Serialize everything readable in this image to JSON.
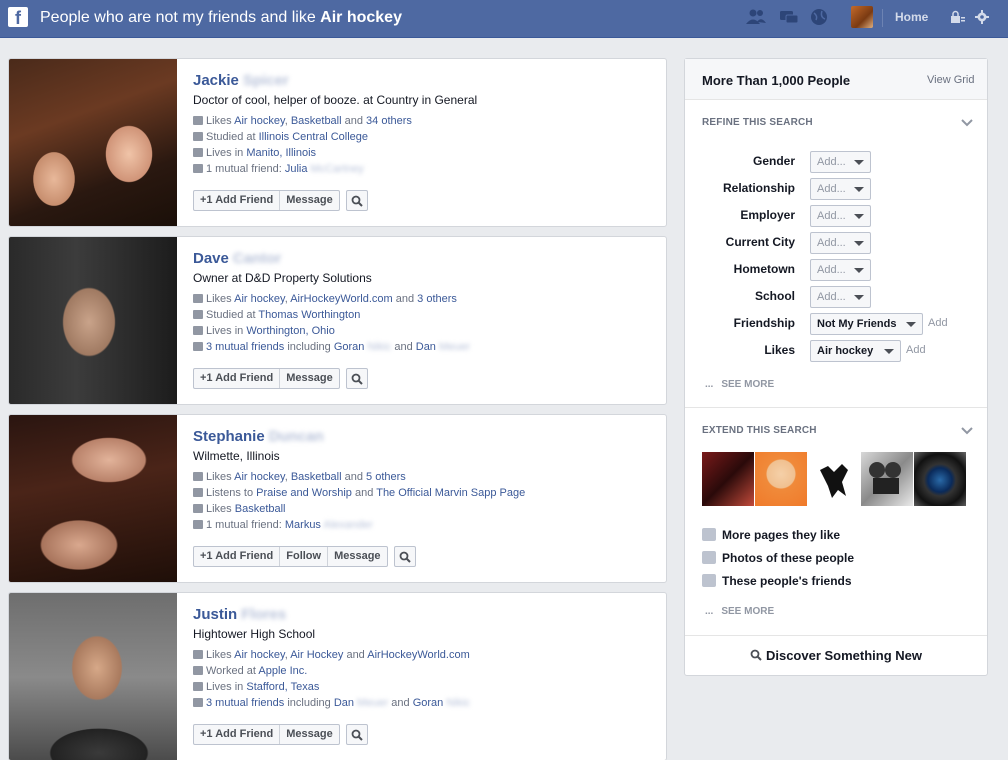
{
  "topbar": {
    "title_prefix": "People who are not my friends and like ",
    "title_bold": "Air hockey",
    "home": "Home"
  },
  "people": [
    {
      "first": "Jackie",
      "last": "Spicer",
      "subtitle": "Doctor of cool, helper of booze. at Country in General",
      "facts": [
        {
          "icon": "like-icon",
          "parts": [
            [
              "Likes ",
              false
            ],
            [
              "Air hockey",
              true
            ],
            [
              ", ",
              false
            ],
            [
              "Basketball",
              true
            ],
            [
              " and ",
              false
            ],
            [
              "34 others",
              true
            ]
          ]
        },
        {
          "icon": "education-icon",
          "parts": [
            [
              "Studied at ",
              false
            ],
            [
              "Illinois Central College",
              true
            ]
          ]
        },
        {
          "icon": "home-icon",
          "parts": [
            [
              "Lives in ",
              false
            ],
            [
              "Manito, Illinois",
              true
            ]
          ]
        },
        {
          "icon": "friends-icon",
          "parts": [
            [
              "1 mutual friend: ",
              false
            ],
            [
              "Julia",
              true
            ],
            [
              " McCartney",
              "blur"
            ]
          ]
        }
      ],
      "buttons": [
        "+1 Add Friend",
        "Message"
      ]
    },
    {
      "first": "Dave",
      "last": "Cantor",
      "subtitle": "Owner at D&D Property Solutions",
      "facts": [
        {
          "icon": "like-icon",
          "parts": [
            [
              "Likes ",
              false
            ],
            [
              "Air hockey",
              true
            ],
            [
              ", ",
              false
            ],
            [
              "AirHockeyWorld.com",
              true
            ],
            [
              " and ",
              false
            ],
            [
              "3 others",
              true
            ]
          ]
        },
        {
          "icon": "education-icon",
          "parts": [
            [
              "Studied at ",
              false
            ],
            [
              "Thomas Worthington",
              true
            ]
          ]
        },
        {
          "icon": "home-icon",
          "parts": [
            [
              "Lives in ",
              false
            ],
            [
              "Worthington, Ohio",
              true
            ]
          ]
        },
        {
          "icon": "friends-icon",
          "parts": [
            [
              "3 mutual friends",
              true
            ],
            [
              " including ",
              false
            ],
            [
              "Goran",
              true
            ],
            [
              " Nikic",
              "blur"
            ],
            [
              " and ",
              false
            ],
            [
              "Dan",
              true
            ],
            [
              " Meuer",
              "blur"
            ]
          ]
        }
      ],
      "buttons": [
        "+1 Add Friend",
        "Message"
      ]
    },
    {
      "first": "Stephanie",
      "last": "Duncan",
      "subtitle": "Wilmette, Illinois",
      "facts": [
        {
          "icon": "like-icon",
          "parts": [
            [
              "Likes ",
              false
            ],
            [
              "Air hockey",
              true
            ],
            [
              ", ",
              false
            ],
            [
              "Basketball",
              true
            ],
            [
              " and ",
              false
            ],
            [
              "5 others",
              true
            ]
          ]
        },
        {
          "icon": "music-icon",
          "parts": [
            [
              "Listens to ",
              false
            ],
            [
              "Praise and Worship",
              true
            ],
            [
              " and ",
              false
            ],
            [
              "The Official Marvin Sapp Page",
              true
            ]
          ]
        },
        {
          "icon": "like-icon",
          "parts": [
            [
              "Likes ",
              false
            ],
            [
              "Basketball",
              true
            ]
          ]
        },
        {
          "icon": "friends-icon",
          "parts": [
            [
              "1 mutual friend: ",
              false
            ],
            [
              "Markus",
              true
            ],
            [
              " Alexander",
              "blur"
            ]
          ]
        }
      ],
      "buttons": [
        "+1 Add Friend",
        "Follow",
        "Message"
      ]
    },
    {
      "first": "Justin",
      "last": "Flores",
      "subtitle": "Hightower High School",
      "facts": [
        {
          "icon": "like-icon",
          "parts": [
            [
              "Likes ",
              false
            ],
            [
              "Air hockey",
              true
            ],
            [
              ", ",
              false
            ],
            [
              "Air Hockey",
              true
            ],
            [
              " and ",
              false
            ],
            [
              "AirHockeyWorld.com",
              true
            ]
          ]
        },
        {
          "icon": "work-icon",
          "parts": [
            [
              "Worked at ",
              false
            ],
            [
              "Apple Inc.",
              true
            ]
          ]
        },
        {
          "icon": "home-icon",
          "parts": [
            [
              "Lives in ",
              false
            ],
            [
              "Stafford, Texas",
              true
            ]
          ]
        },
        {
          "icon": "friends-icon",
          "parts": [
            [
              "3 mutual friends",
              true
            ],
            [
              " including ",
              false
            ],
            [
              "Dan",
              true
            ],
            [
              " Meuer",
              "blur"
            ],
            [
              " and ",
              false
            ],
            [
              "Goran",
              true
            ],
            [
              " Nikic",
              "blur"
            ]
          ]
        }
      ],
      "buttons": [
        "+1 Add Friend",
        "Message"
      ]
    }
  ],
  "sidebar": {
    "count": "More Than 1,000 People",
    "view_grid": "View Grid",
    "refine_title": "REFINE THIS SEARCH",
    "filters": [
      {
        "label": "Gender",
        "value": "Add...",
        "active": false,
        "add": ""
      },
      {
        "label": "Relationship",
        "value": "Add...",
        "active": false,
        "add": ""
      },
      {
        "label": "Employer",
        "value": "Add...",
        "active": false,
        "add": ""
      },
      {
        "label": "Current City",
        "value": "Add...",
        "active": false,
        "add": ""
      },
      {
        "label": "Hometown",
        "value": "Add...",
        "active": false,
        "add": ""
      },
      {
        "label": "School",
        "value": "Add...",
        "active": false,
        "add": ""
      },
      {
        "label": "Friendship",
        "value": "Not My Friends",
        "active": true,
        "add": "Add"
      },
      {
        "label": "Likes",
        "value": "Air hockey",
        "active": true,
        "add": "Add"
      }
    ],
    "see_more": "SEE MORE",
    "extend_title": "EXTEND THIS SEARCH",
    "extend_items": [
      "More pages they like",
      "Photos of these people",
      "These people's friends"
    ],
    "see_more_2": "SEE MORE",
    "discover": "Discover Something New"
  }
}
